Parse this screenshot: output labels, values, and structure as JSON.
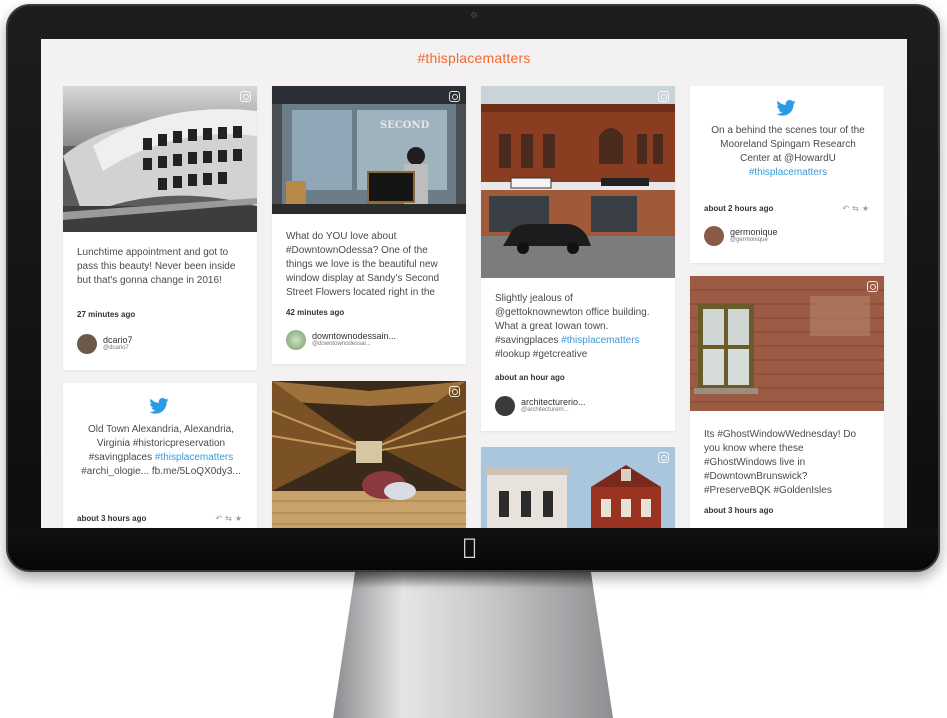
{
  "page": {
    "title": "#thisplacematters"
  },
  "cards": {
    "c1": {
      "text": "Lunchtime appointment and got to pass this beauty! Never been inside but that's gonna change in 2016!",
      "time": "27 minutes ago",
      "user": "dcario7",
      "handle": "@dcario7"
    },
    "c2": {
      "text": "Old Town Alexandria, Alexandria, Virginia #historicpreservation #savingplaces",
      "tag": "#thisplacematters",
      "text2": "#archi_ologie... fb.me/5LoQX0dy3...",
      "time": "about 3 hours ago"
    },
    "c3": {
      "text": "What do YOU love about #DowntownOdessa? One of the things we love is the beautiful new window display at Sandy's Second Street Flowers located right in the",
      "time": "42 minutes ago",
      "user": "downtownodessain...",
      "handle": "@downtownodessai..."
    },
    "c5": {
      "text": "Slightly jealous of @gettoknownewton office building. What a great Iowan town. #savingplaces",
      "tag": "#thisplacematters",
      "text2": "#lookup #getcreative",
      "time": "about an hour ago",
      "user": "architecturerio...",
      "handle": "@architecturerri..."
    },
    "c7": {
      "text": "On a behind the scenes tour of the Mooreland Spingarn Research Center at @HowardU",
      "tag": "#thisplacematters",
      "time": "about 2 hours ago",
      "user": "germonique",
      "handle": "@germonique"
    },
    "c8": {
      "text": "Its #GhostWindowWednesday! Do you know where these #GhostWindows live in #DowntownBrunswick? #PreserveBQK #GoldenIsles",
      "time": "about 3 hours ago"
    }
  },
  "icons": {
    "twitter": "twitter-bird-icon",
    "instagram": "instagram-icon",
    "reply": "reply-icon",
    "retweet": "retweet-icon",
    "favorite": "star-icon"
  },
  "colors": {
    "accent": "#f26a2e",
    "link": "#3a9ad9",
    "twitter": "#2d9be3",
    "screen_bg": "#f3f1f1"
  }
}
